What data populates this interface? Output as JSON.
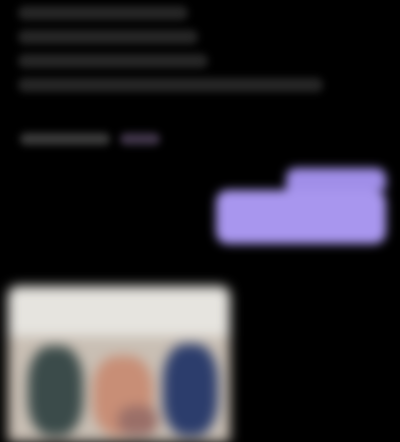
{
  "conversation": {
    "incoming_message": {
      "visible_lines": 4
    },
    "incoming_meta": {
      "icon": "reaction-icon"
    },
    "outgoing_message": {
      "bubble_color": "#a896ee"
    },
    "shared_photo": {
      "icon": "photo-thumbnail"
    }
  },
  "colors": {
    "background": "#000000",
    "outgoing_bubble": "#a896ee",
    "text_placeholder": "#262626"
  }
}
